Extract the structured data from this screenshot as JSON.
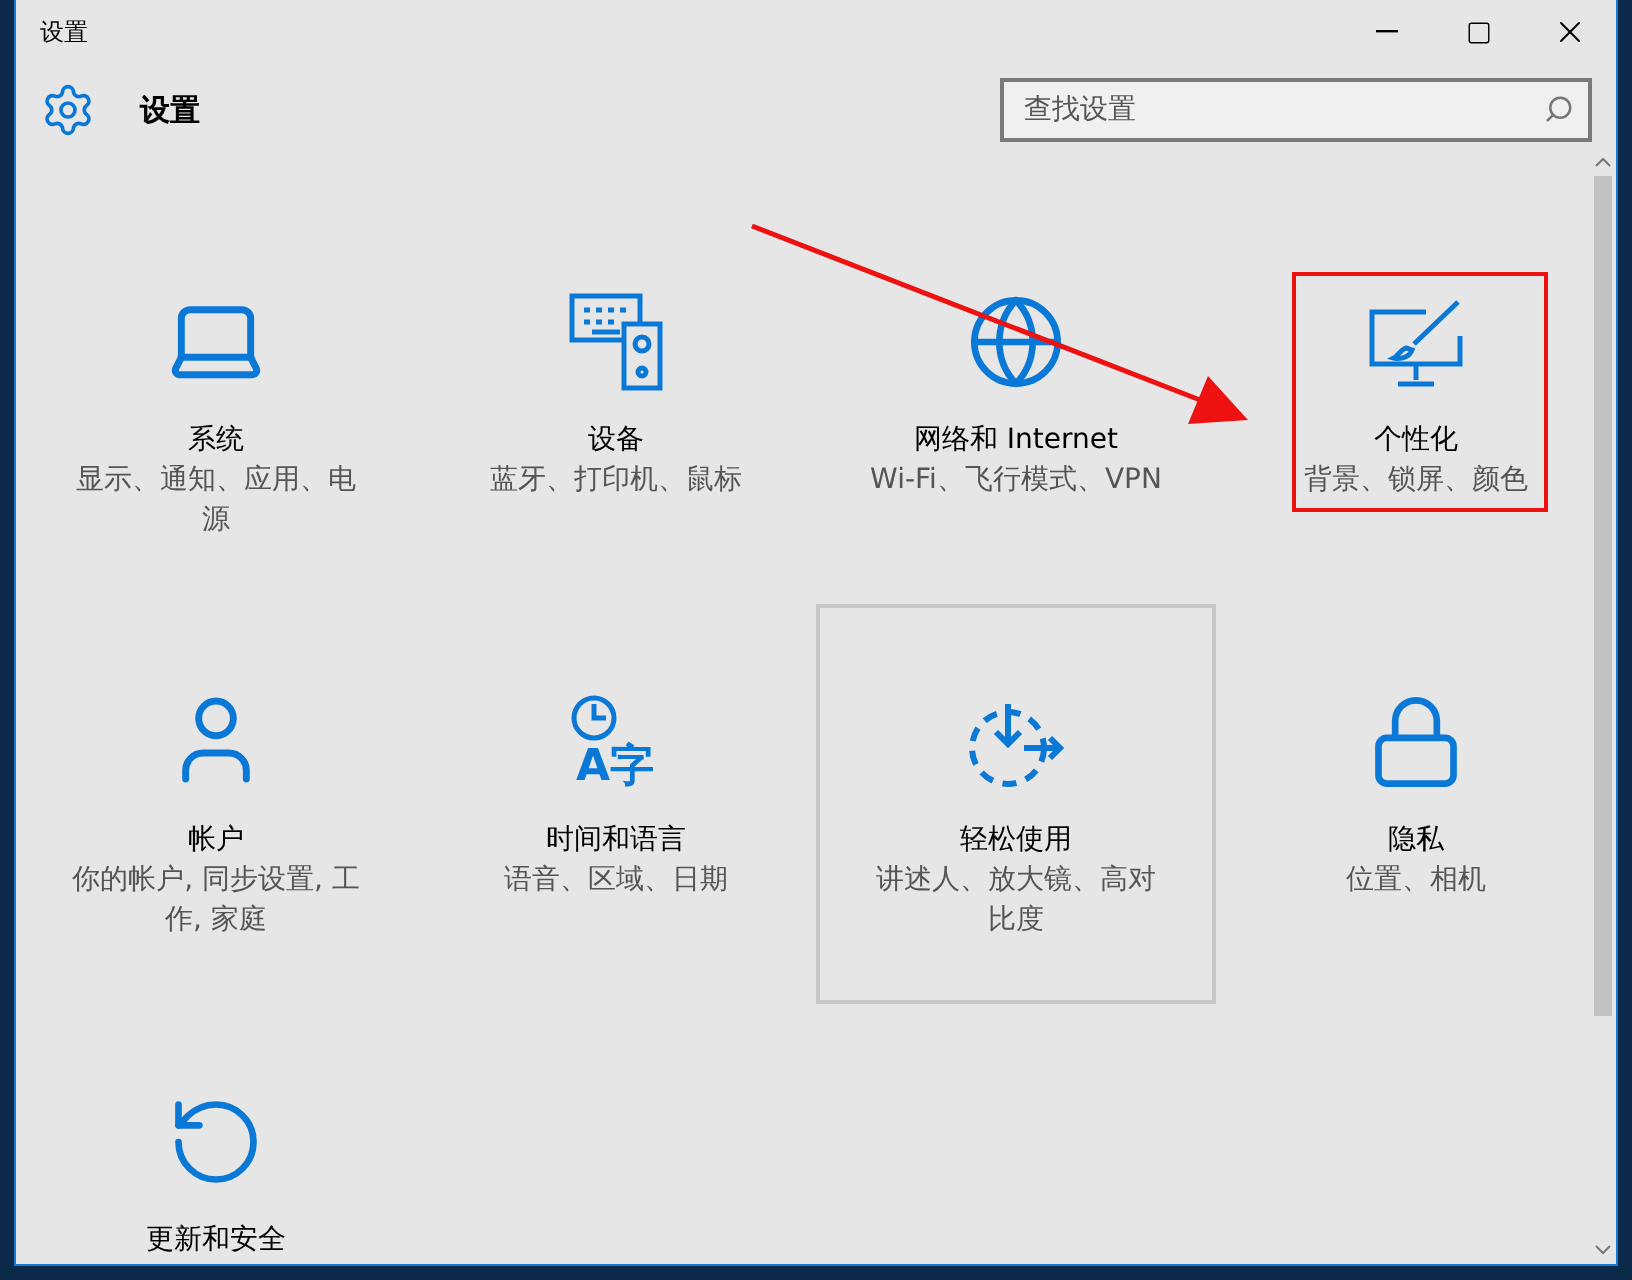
{
  "window": {
    "title": "设置"
  },
  "header": {
    "title": "设置",
    "search": {
      "placeholder": "查找设置"
    }
  },
  "tiles": [
    {
      "kind": "laptop",
      "title": "系统",
      "subtitle": "显示、通知、应用、电源",
      "hovered": false,
      "annotated": false
    },
    {
      "kind": "devices",
      "title": "设备",
      "subtitle": "蓝牙、打印机、鼠标",
      "hovered": false,
      "annotated": false
    },
    {
      "kind": "globe",
      "title": "网络和 Internet",
      "subtitle": "Wi-Fi、飞行模式、VPN",
      "hovered": false,
      "annotated": false
    },
    {
      "kind": "personalize",
      "title": "个性化",
      "subtitle": "背景、锁屏、颜色",
      "hovered": false,
      "annotated": true
    },
    {
      "kind": "person",
      "title": "帐户",
      "subtitle": "你的帐户, 同步设置, 工作, 家庭",
      "hovered": false,
      "annotated": false
    },
    {
      "kind": "time-language",
      "icon_text": "A字",
      "title": "时间和语言",
      "subtitle": "语音、区域、日期",
      "hovered": false,
      "annotated": false
    },
    {
      "kind": "ease",
      "title": "轻松使用",
      "subtitle": "讲述人、放大镜、高对比度",
      "hovered": true,
      "annotated": false
    },
    {
      "kind": "lock",
      "title": "隐私",
      "subtitle": "位置、相机",
      "hovered": false,
      "annotated": false
    },
    {
      "kind": "update",
      "title": "更新和安全",
      "hovered": false,
      "annotated": false
    }
  ]
}
